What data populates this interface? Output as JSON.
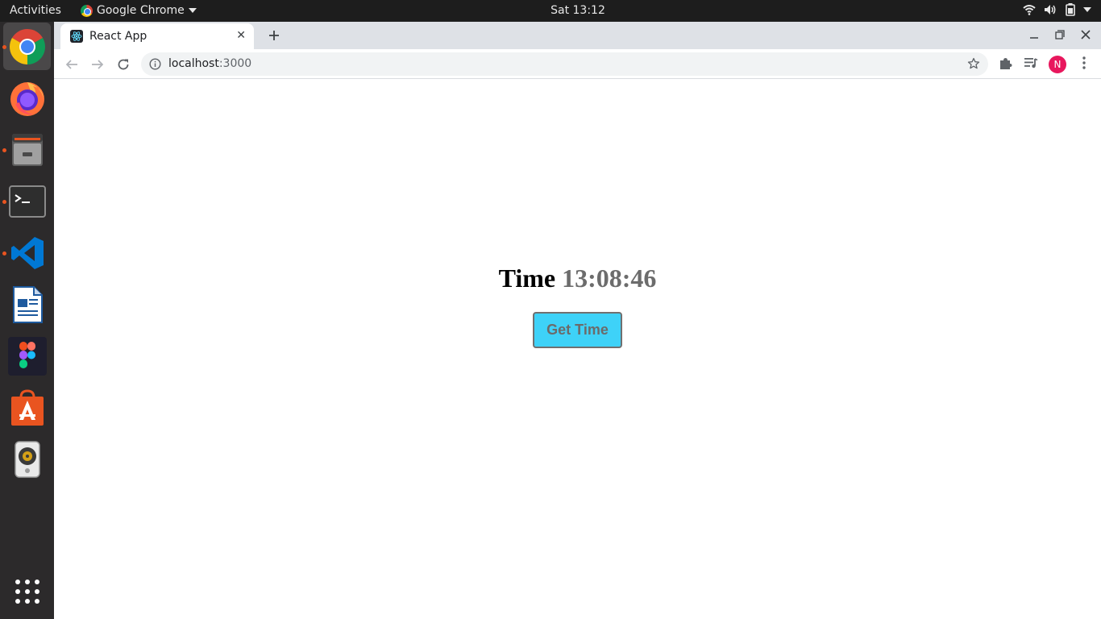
{
  "topbar": {
    "activities": "Activities",
    "app_name": "Google Chrome",
    "clock": "Sat 13:12"
  },
  "dock": {
    "apps": [
      "Google Chrome",
      "Firefox",
      "Files",
      "Terminal",
      "Visual Studio Code",
      "LibreOffice Writer",
      "Figma",
      "Ubuntu Software",
      "Rhythmbox"
    ],
    "show_apps_icon": "grid-icon"
  },
  "browser": {
    "tab_title": "React App",
    "url_host": "localhost",
    "url_port": ":3000",
    "profile_initial": "N",
    "profile_color": "#e8175d"
  },
  "page": {
    "time_label": "Time",
    "time_value": "13:08:46",
    "button_label": "Get Time",
    "button_color": "#3ed2f8"
  }
}
